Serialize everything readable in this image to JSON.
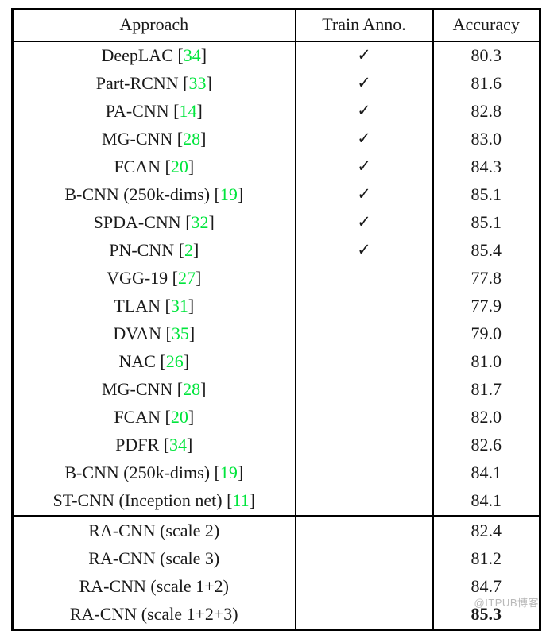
{
  "table": {
    "columns": [
      "Approach",
      "Train Anno.",
      "Accuracy"
    ],
    "check_glyph": "✓",
    "ref_color": "#00e53c",
    "rows": [
      {
        "approach": "DeepLAC",
        "ref": "34",
        "anno": true,
        "accuracy": "80.3",
        "bold": false,
        "section": 1
      },
      {
        "approach": "Part-RCNN",
        "ref": "33",
        "anno": true,
        "accuracy": "81.6",
        "bold": false,
        "section": 1
      },
      {
        "approach": "PA-CNN",
        "ref": "14",
        "anno": true,
        "accuracy": "82.8",
        "bold": false,
        "section": 1
      },
      {
        "approach": "MG-CNN",
        "ref": "28",
        "anno": true,
        "accuracy": "83.0",
        "bold": false,
        "section": 1
      },
      {
        "approach": "FCAN",
        "ref": "20",
        "anno": true,
        "accuracy": "84.3",
        "bold": false,
        "section": 1
      },
      {
        "approach": "B-CNN (250k-dims)",
        "ref": "19",
        "anno": true,
        "accuracy": "85.1",
        "bold": false,
        "section": 1
      },
      {
        "approach": "SPDA-CNN",
        "ref": "32",
        "anno": true,
        "accuracy": "85.1",
        "bold": false,
        "section": 1
      },
      {
        "approach": "PN-CNN",
        "ref": "2",
        "anno": true,
        "accuracy": "85.4",
        "bold": false,
        "section": 1
      },
      {
        "approach": "VGG-19",
        "ref": "27",
        "anno": false,
        "accuracy": "77.8",
        "bold": false,
        "section": 1
      },
      {
        "approach": "TLAN",
        "ref": "31",
        "anno": false,
        "accuracy": "77.9",
        "bold": false,
        "section": 1
      },
      {
        "approach": "DVAN",
        "ref": "35",
        "anno": false,
        "accuracy": "79.0",
        "bold": false,
        "section": 1
      },
      {
        "approach": "NAC",
        "ref": "26",
        "anno": false,
        "accuracy": "81.0",
        "bold": false,
        "section": 1
      },
      {
        "approach": "MG-CNN",
        "ref": "28",
        "anno": false,
        "accuracy": "81.7",
        "bold": false,
        "section": 1
      },
      {
        "approach": "FCAN",
        "ref": "20",
        "anno": false,
        "accuracy": "82.0",
        "bold": false,
        "section": 1
      },
      {
        "approach": "PDFR",
        "ref": "34",
        "anno": false,
        "accuracy": "82.6",
        "bold": false,
        "section": 1
      },
      {
        "approach": "B-CNN (250k-dims)",
        "ref": "19",
        "anno": false,
        "accuracy": "84.1",
        "bold": false,
        "section": 1
      },
      {
        "approach": "ST-CNN (Inception net)",
        "ref": "11",
        "anno": false,
        "accuracy": "84.1",
        "bold": false,
        "section": 1
      },
      {
        "approach": "RA-CNN (scale 2)",
        "ref": "",
        "anno": false,
        "accuracy": "82.4",
        "bold": false,
        "section": 2
      },
      {
        "approach": "RA-CNN (scale 3)",
        "ref": "",
        "anno": false,
        "accuracy": "81.2",
        "bold": false,
        "section": 2
      },
      {
        "approach": "RA-CNN (scale 1+2)",
        "ref": "",
        "anno": false,
        "accuracy": "84.7",
        "bold": false,
        "section": 2
      },
      {
        "approach": "RA-CNN (scale 1+2+3)",
        "ref": "",
        "anno": false,
        "accuracy": "85.3",
        "bold": true,
        "section": 2
      }
    ]
  },
  "watermark": "@ITPUB博客"
}
